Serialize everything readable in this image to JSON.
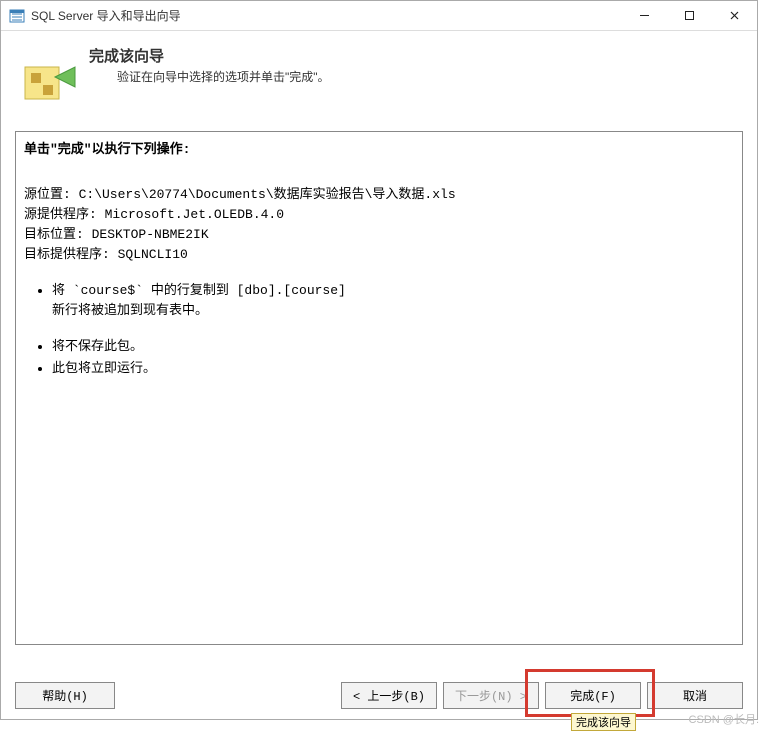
{
  "titlebar": {
    "title": "SQL Server 导入和导出向导"
  },
  "header": {
    "title": "完成该向导",
    "subtitle": "验证在向导中选择的选项并单击\"完成\"。"
  },
  "content": {
    "intro": "单击\"完成\"以执行下列操作:",
    "lines": {
      "src_loc": "源位置: C:\\Users\\20774\\Documents\\数据库实验报告\\导入数据.xls",
      "src_prov": "源提供程序: Microsoft.Jet.OLEDB.4.0",
      "dst_loc": "目标位置: DESKTOP-NBME2IK",
      "dst_prov": "目标提供程序: SQLNCLI10"
    },
    "bullets1": {
      "b1": "将 `course$` 中的行复制到 [dbo].[course]",
      "b1sub": "新行将被追加到现有表中。"
    },
    "bullets2": {
      "b1": "将不保存此包。",
      "b2": "此包将立即运行。"
    }
  },
  "buttons": {
    "help": "帮助(H)",
    "back": "< 上一步(B)",
    "next": "下一步(N) >",
    "finish": "完成(F)",
    "cancel": "取消"
  },
  "tooltip": "完成该向导",
  "watermark": "CSDN @长月."
}
